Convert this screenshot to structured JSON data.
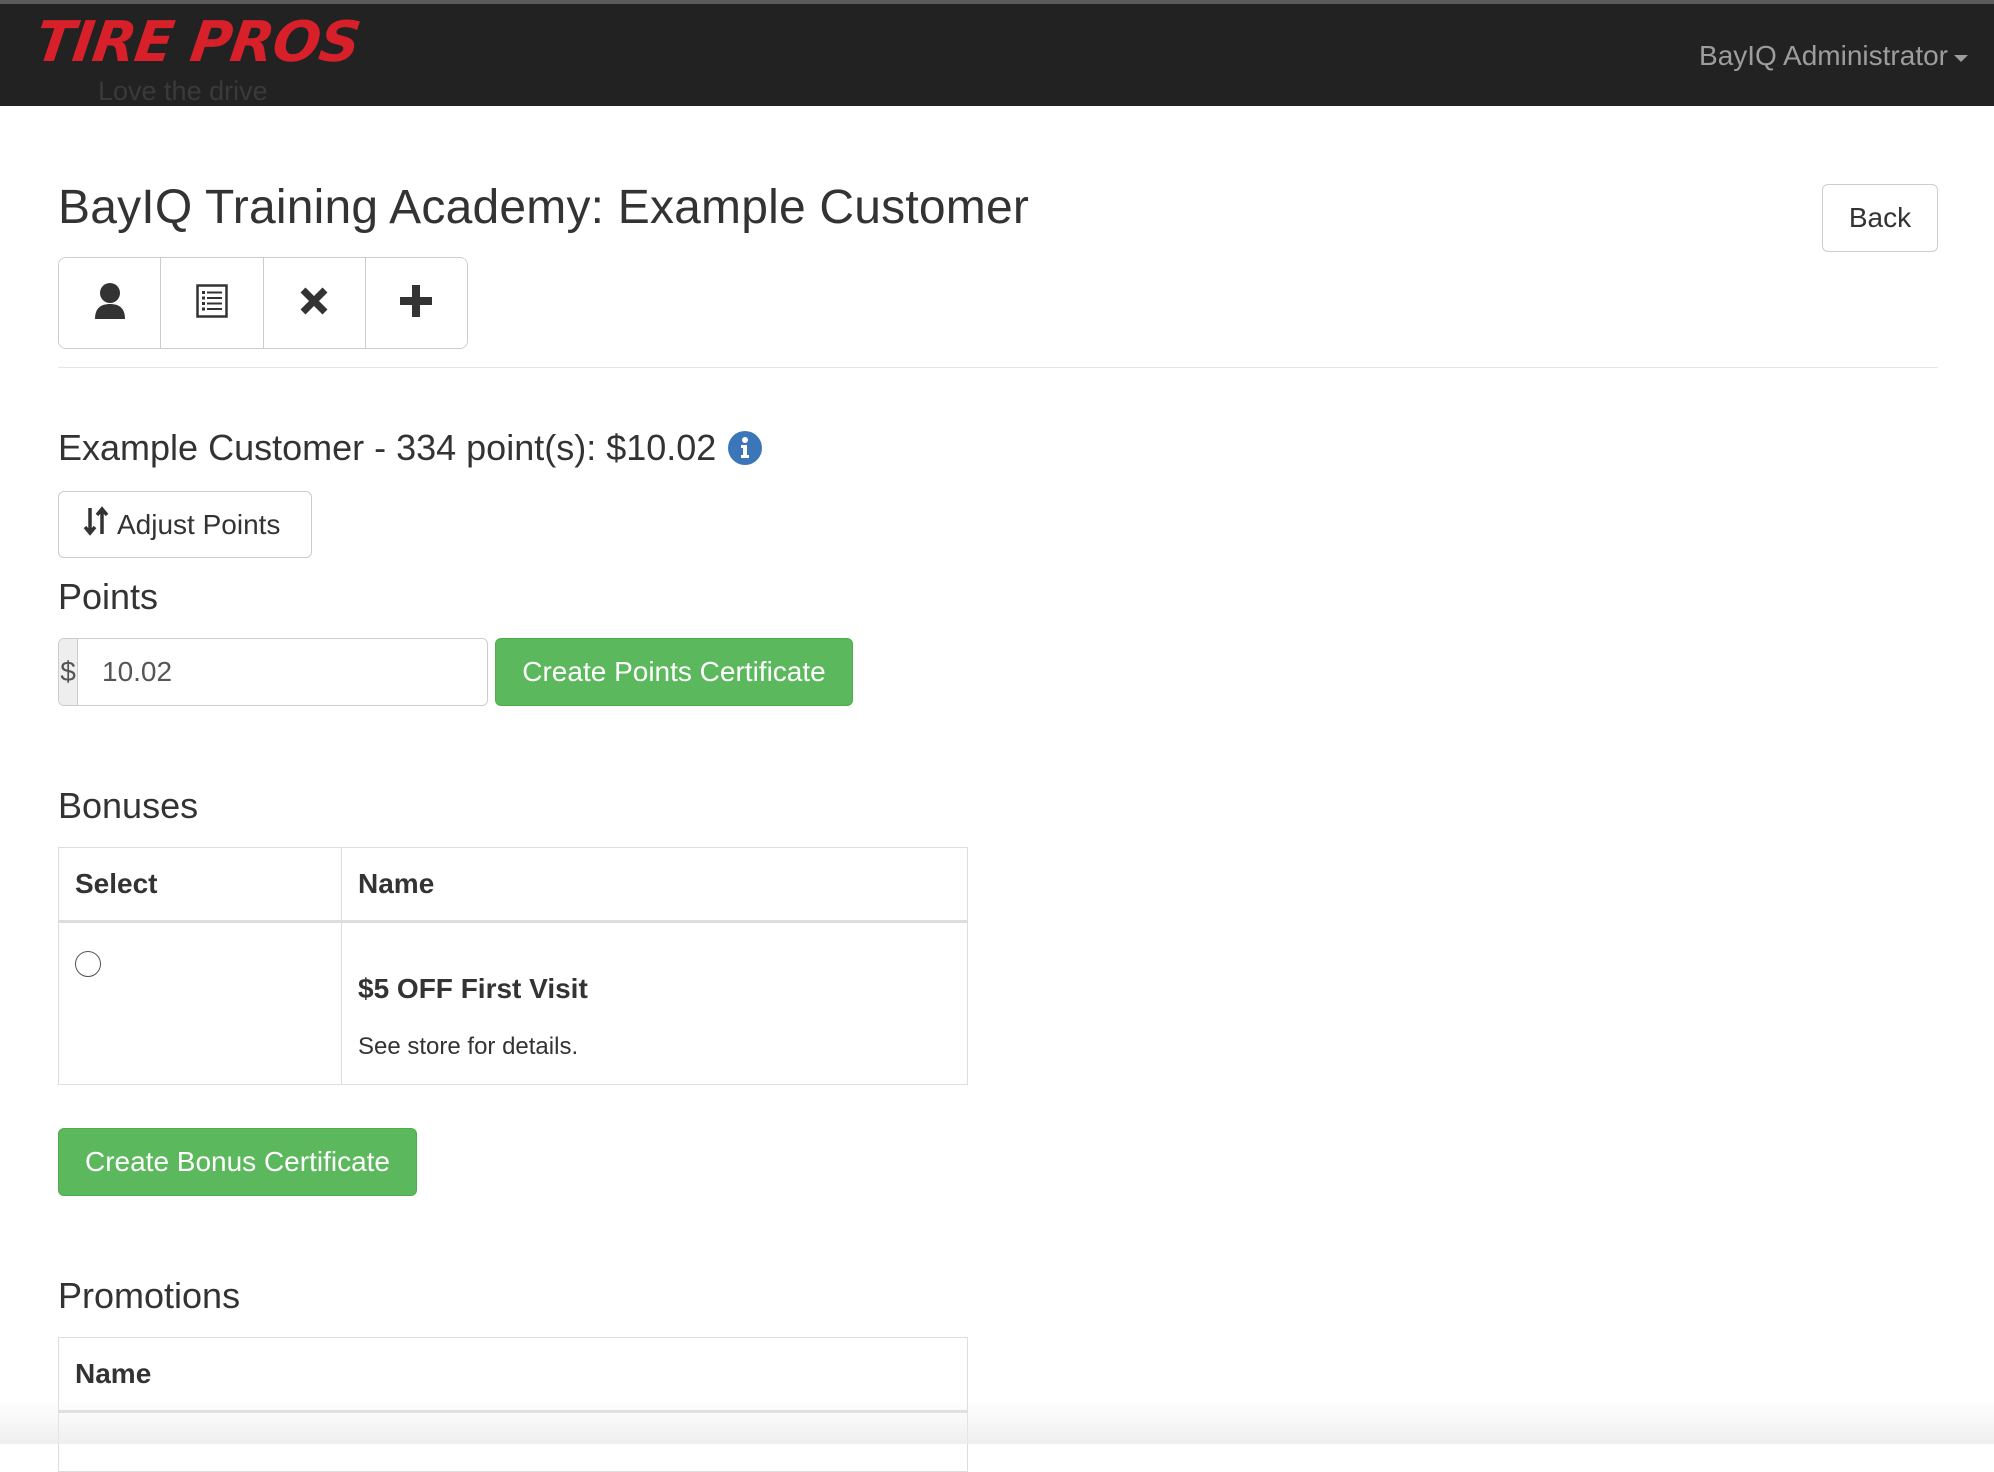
{
  "navbar": {
    "brand": "TIRE PROS",
    "tagline": "Love the drive",
    "user_menu": "BayIQ Administrator"
  },
  "header": {
    "title": "BayIQ Training Academy: Example Customer",
    "back_label": "Back",
    "icon_buttons": [
      "user-icon",
      "list-icon",
      "remove-icon",
      "plus-icon"
    ]
  },
  "points": {
    "summary": "Example Customer - 334 point(s): $10.02",
    "adjust_label": "Adjust Points",
    "heading": "Points",
    "currency_symbol": "$",
    "amount_value": "10.02",
    "create_label": "Create Points Certificate"
  },
  "bonuses": {
    "heading": "Bonuses",
    "columns": [
      "Select",
      "Name"
    ],
    "rows": [
      {
        "name": "$5 OFF First Visit",
        "description": "See store for details."
      }
    ],
    "create_label": "Create Bonus Certificate"
  },
  "promotions": {
    "heading": "Promotions",
    "columns": [
      "Name"
    ]
  },
  "colors": {
    "navbar_bg": "#222222",
    "brand_red": "#d8202a",
    "success_green": "#5cb85c",
    "info_blue": "#3a76b8"
  }
}
